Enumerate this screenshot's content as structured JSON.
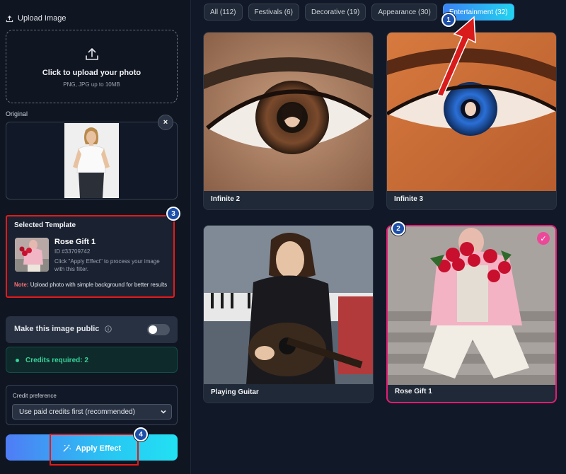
{
  "sidebar": {
    "upload_heading": "Upload Image",
    "dropzone_title": "Click to upload your photo",
    "dropzone_sub": "PNG, JPG up to 10MB",
    "original_label": "Original",
    "close_symbol": "×",
    "selected": {
      "heading": "Selected Template",
      "name": "Rose Gift 1",
      "id_text": "ID #33709742",
      "description": "Click \"Apply Effect\" to process your image with this filter.",
      "note_label": "Note:",
      "note_text": "Upload photo with simple background for better results"
    },
    "public_label": "Make this image public",
    "public_on": false,
    "credits_text": "Credits required: 2",
    "pref_label": "Credit preference",
    "pref_value": "Use paid credits first (recommended)",
    "apply_label": "Apply Effect"
  },
  "tabs": [
    {
      "label": "All (112)",
      "active": false
    },
    {
      "label": "Festivals (6)",
      "active": false
    },
    {
      "label": "Decorative (19)",
      "active": false
    },
    {
      "label": "Appearance (30)",
      "active": false
    },
    {
      "label": "Entertainment (32)",
      "active": true
    }
  ],
  "cards": [
    {
      "caption": "Infinite 2",
      "selected": false
    },
    {
      "caption": "Infinite 3",
      "selected": false
    },
    {
      "caption": "Playing Guitar",
      "selected": false
    },
    {
      "caption": "Rose Gift 1",
      "selected": true
    }
  ],
  "annotations": {
    "badge_1": "1",
    "badge_2": "2",
    "badge_3": "3",
    "badge_4": "4",
    "highlight_color": "#e31a1a",
    "arrow_color": "#e31a1a"
  },
  "colors": {
    "accent_start": "#3b82f6",
    "accent_end": "#22d3ee",
    "success": "#34d399",
    "selected_border": "#e11d74"
  },
  "icons": {
    "upload": "upload-icon",
    "info": "info-icon",
    "chevron": "chevron-down-icon",
    "magic": "magic-wand-icon",
    "check": "check-icon"
  },
  "check_symbol": "✓"
}
